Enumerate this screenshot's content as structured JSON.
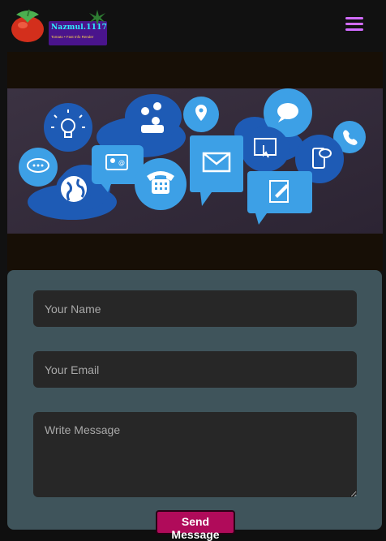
{
  "header": {
    "logo_title": "Nazmul.1117",
    "logo_subtitle": "Tomato • Fast Info Render",
    "menu_icon": "hamburger-menu-icon"
  },
  "banner": {
    "icons": [
      "lightbulb-icon",
      "people-icon",
      "map-pin-icon",
      "chat-bubble-icon",
      "phone-icon",
      "envelope-icon",
      "touch-screen-icon",
      "mobile-chat-icon",
      "phone-call-icon",
      "contact-card-icon",
      "globe-icon",
      "notepad-icon",
      "speech-icon"
    ],
    "accent_dark": "#1e5bb5",
    "accent_light": "#3da0e6"
  },
  "contact_form": {
    "name_placeholder": "Your Name",
    "email_placeholder": "Your Email",
    "message_placeholder": "Write Message",
    "send_label": "Send Message"
  },
  "colors": {
    "page_bg": "#111111",
    "form_bg": "#3f545b",
    "field_bg": "#272727",
    "button_bg": "#b00b5a",
    "menu_color": "#d16bff"
  }
}
